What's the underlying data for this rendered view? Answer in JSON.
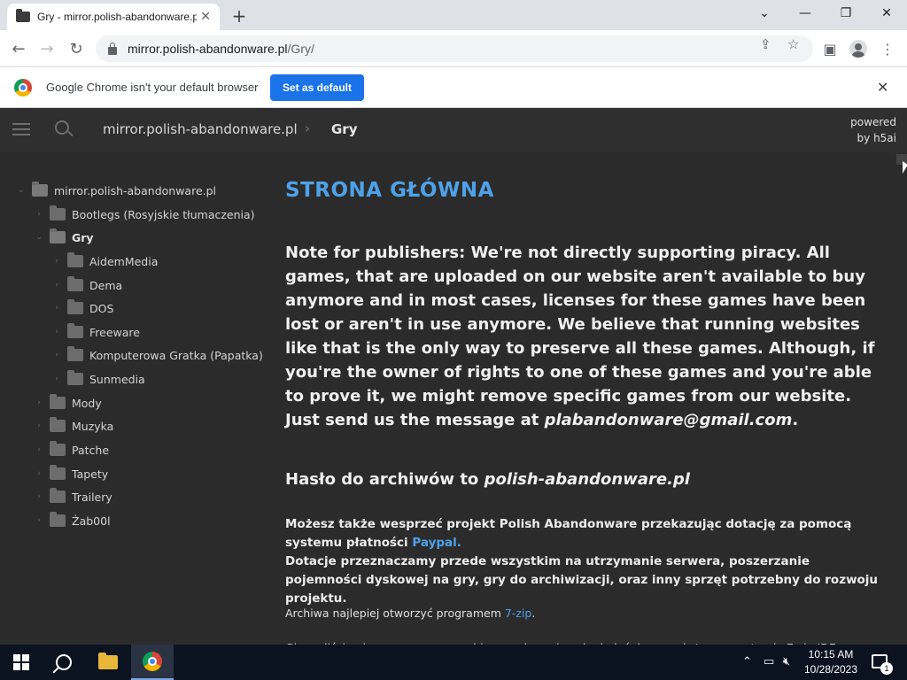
{
  "browser": {
    "tab_title": "Gry - mirror.polish-abandonware.pl/Gry/",
    "tab_close": "✕",
    "new_tab": "+",
    "url_host": "mirror.polish-abandonware.pl",
    "url_path": "/Gry/",
    "infobar_text": "Google Chrome isn't your default browser",
    "set_default_label": "Set as default",
    "infobar_close": "✕"
  },
  "header": {
    "crumb_root": "mirror.polish-abandonware.pl",
    "crumb_sep": "›",
    "crumb_current": "Gry",
    "powered_line1": "powered",
    "powered_line2": "by h5ai"
  },
  "tree": {
    "root": "mirror.polish-abandonware.pl",
    "items": [
      {
        "label": "Bootlegs (Rosyjskie tłumaczenia)"
      },
      {
        "label": "Gry"
      },
      {
        "label": "AidemMedia"
      },
      {
        "label": "Dema"
      },
      {
        "label": "DOS"
      },
      {
        "label": "Freeware"
      },
      {
        "label": "Komputerowa Gratka (Papatka)"
      },
      {
        "label": "Sunmedia"
      },
      {
        "label": "Mody"
      },
      {
        "label": "Muzyka"
      },
      {
        "label": "Patche"
      },
      {
        "label": "Tapety"
      },
      {
        "label": "Trailery"
      },
      {
        "label": "Żab00l"
      }
    ]
  },
  "content": {
    "heading": "STRONA GŁÓWNA",
    "note_text": "Note for publishers: We're not directly supporting piracy. All games, that are uploaded on our website aren't available to buy anymore and in most cases, licenses for these games have been lost or aren't in use anymore. We believe that running websites like that is the only way to preserve all these games. Although, if you're the owner of rights to one of these games and you're able to prove it, we might remove specific games from our website. Just send us the message at ",
    "note_email": "plabandonware@gmail.com",
    "note_end": ".",
    "haslo_prefix": "Hasło do archiwów to ",
    "haslo_value": "polish-abandonware.pl",
    "donate_text": "Możesz także wesprzeć projekt Polish Abandonware przekazując dotację za pomocą systemu płatności ",
    "donate_link": "Paypal.",
    "donate_text2": "Dotacje przeznaczamy przede wszystkim na utrzymanie serwera, poszerzanie pojemności dyskowej na gry, gry do archiwizacji, oraz inny sprzęt potrzebny do rozwoju projektu.",
    "archive_text": "Archiwa najlepiej otworzyć programem ",
    "archive_link": "7-zip",
    "archive_end": ".",
    "cut_text": "Gier w liście nie ma w naszym archiwum, ale możesz je dodać do naszej strony na stronie 7-zip.IDE"
  },
  "taskbar": {
    "time": "10:15 AM",
    "date": "10/28/2023",
    "notif_count": "1"
  }
}
